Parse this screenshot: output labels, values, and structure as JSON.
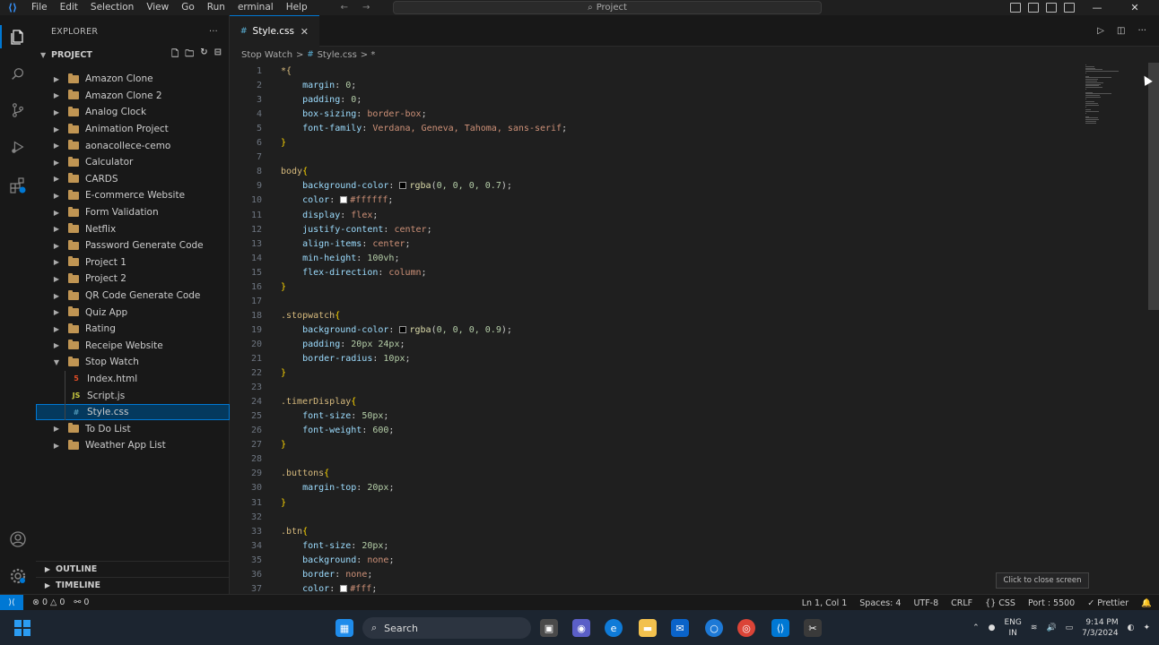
{
  "titlebar": {
    "menus": [
      "File",
      "Edit",
      "Selection",
      "View",
      "Go",
      "Run",
      "erminal",
      "Help"
    ],
    "search_text": "Project"
  },
  "sidebar": {
    "header": "EXPLORER",
    "project": "PROJECT",
    "folders_top": [
      "Amazon Clone",
      "Amazon Clone 2",
      "Analog Clock",
      "Animation Project",
      "aonacollece-cemo",
      "Calculator",
      "CARDS",
      "E-commerce Website",
      "Form Validation",
      "Netflix",
      "Password Generate Code",
      "Project 1",
      "Project 2",
      "QR Code Generate Code",
      "Quiz App",
      "Rating",
      "Receipe Website"
    ],
    "open_folder": "Stop Watch",
    "files": [
      {
        "icon": "5",
        "icon_color": "#e44d26",
        "name": "Index.html"
      },
      {
        "icon": "JS",
        "icon_color": "#cbcb41",
        "name": "Script.js"
      },
      {
        "icon": "#",
        "icon_color": "#519aba",
        "name": "Style.css"
      }
    ],
    "folders_bottom": [
      "To Do List",
      "Weather App List"
    ],
    "outline": "OUTLINE",
    "timeline": "TIMELINE"
  },
  "tab": {
    "label": "Style.css",
    "close": "✕"
  },
  "breadcrumb": {
    "folder": "Stop Watch",
    "sep": ">",
    "file": "Style.css",
    "extra": "> *"
  },
  "code_lines": [
    {
      "n": "1",
      "parts": [
        [
          "sel",
          "*{"
        ]
      ]
    },
    {
      "n": "2",
      "parts": [
        [
          "prop",
          "    margin"
        ],
        [
          "punc",
          ": "
        ],
        [
          "num",
          "0"
        ],
        [
          "punc",
          ";"
        ]
      ]
    },
    {
      "n": "3",
      "parts": [
        [
          "prop",
          "    padding"
        ],
        [
          "punc",
          ": "
        ],
        [
          "num",
          "0"
        ],
        [
          "punc",
          ";"
        ]
      ]
    },
    {
      "n": "4",
      "parts": [
        [
          "prop",
          "    box-sizing"
        ],
        [
          "punc",
          ": "
        ],
        [
          "val",
          "border-box"
        ],
        [
          "punc",
          ";"
        ]
      ]
    },
    {
      "n": "5",
      "parts": [
        [
          "prop",
          "    font-family"
        ],
        [
          "punc",
          ": "
        ],
        [
          "val",
          "Verdana, Geneva, Tahoma, sans-serif"
        ],
        [
          "punc",
          ";"
        ]
      ]
    },
    {
      "n": "6",
      "parts": [
        [
          "brace",
          "}"
        ]
      ]
    },
    {
      "n": "7",
      "parts": []
    },
    {
      "n": "8",
      "parts": [
        [
          "sel",
          "body"
        ],
        [
          "brace",
          "{"
        ]
      ]
    },
    {
      "n": "9",
      "parts": [
        [
          "prop",
          "    background-color"
        ],
        [
          "punc",
          ": "
        ],
        [
          "swatch",
          "#000000"
        ],
        [
          "fn",
          "rgba"
        ],
        [
          "punc",
          "("
        ],
        [
          "num",
          "0, 0, 0, 0.7"
        ],
        [
          "punc",
          ");"
        ]
      ]
    },
    {
      "n": "10",
      "parts": [
        [
          "prop",
          "    color"
        ],
        [
          "punc",
          ": "
        ],
        [
          "swatch",
          "#ffffff"
        ],
        [
          "val",
          "#ffffff"
        ],
        [
          "punc",
          ";"
        ]
      ]
    },
    {
      "n": "11",
      "parts": [
        [
          "prop",
          "    display"
        ],
        [
          "punc",
          ": "
        ],
        [
          "val",
          "flex"
        ],
        [
          "punc",
          ";"
        ]
      ]
    },
    {
      "n": "12",
      "parts": [
        [
          "prop",
          "    justify-content"
        ],
        [
          "punc",
          ": "
        ],
        [
          "val",
          "center"
        ],
        [
          "punc",
          ";"
        ]
      ]
    },
    {
      "n": "13",
      "parts": [
        [
          "prop",
          "    align-items"
        ],
        [
          "punc",
          ": "
        ],
        [
          "val",
          "center"
        ],
        [
          "punc",
          ";"
        ]
      ]
    },
    {
      "n": "14",
      "parts": [
        [
          "prop",
          "    min-height"
        ],
        [
          "punc",
          ": "
        ],
        [
          "num",
          "100vh"
        ],
        [
          "punc",
          ";"
        ]
      ]
    },
    {
      "n": "15",
      "parts": [
        [
          "prop",
          "    flex-direction"
        ],
        [
          "punc",
          ": "
        ],
        [
          "val",
          "column"
        ],
        [
          "punc",
          ";"
        ]
      ]
    },
    {
      "n": "16",
      "parts": [
        [
          "brace",
          "}"
        ]
      ]
    },
    {
      "n": "17",
      "parts": []
    },
    {
      "n": "18",
      "parts": [
        [
          "sel",
          ".stopwatch"
        ],
        [
          "brace",
          "{"
        ]
      ]
    },
    {
      "n": "19",
      "parts": [
        [
          "prop",
          "    background-color"
        ],
        [
          "punc",
          ": "
        ],
        [
          "swatch",
          "#000000"
        ],
        [
          "fn",
          "rgba"
        ],
        [
          "punc",
          "("
        ],
        [
          "num",
          "0, 0, 0, 0.9"
        ],
        [
          "punc",
          ");"
        ]
      ]
    },
    {
      "n": "20",
      "parts": [
        [
          "prop",
          "    padding"
        ],
        [
          "punc",
          ": "
        ],
        [
          "num",
          "20px 24px"
        ],
        [
          "punc",
          ";"
        ]
      ]
    },
    {
      "n": "21",
      "parts": [
        [
          "prop",
          "    border-radius"
        ],
        [
          "punc",
          ": "
        ],
        [
          "num",
          "10px"
        ],
        [
          "punc",
          ";"
        ]
      ]
    },
    {
      "n": "22",
      "parts": [
        [
          "brace",
          "}"
        ]
      ]
    },
    {
      "n": "23",
      "parts": []
    },
    {
      "n": "24",
      "parts": [
        [
          "sel",
          ".timerDisplay"
        ],
        [
          "brace",
          "{"
        ]
      ]
    },
    {
      "n": "25",
      "parts": [
        [
          "prop",
          "    font-size"
        ],
        [
          "punc",
          ": "
        ],
        [
          "num",
          "50px"
        ],
        [
          "punc",
          ";"
        ]
      ]
    },
    {
      "n": "26",
      "parts": [
        [
          "prop",
          "    font-weight"
        ],
        [
          "punc",
          ": "
        ],
        [
          "num",
          "600"
        ],
        [
          "punc",
          ";"
        ]
      ]
    },
    {
      "n": "27",
      "parts": [
        [
          "brace",
          "}"
        ]
      ]
    },
    {
      "n": "28",
      "parts": []
    },
    {
      "n": "29",
      "parts": [
        [
          "sel",
          ".buttons"
        ],
        [
          "brace",
          "{"
        ]
      ]
    },
    {
      "n": "30",
      "parts": [
        [
          "prop",
          "    margin-top"
        ],
        [
          "punc",
          ": "
        ],
        [
          "num",
          "20px"
        ],
        [
          "punc",
          ";"
        ]
      ]
    },
    {
      "n": "31",
      "parts": [
        [
          "brace",
          "}"
        ]
      ]
    },
    {
      "n": "32",
      "parts": []
    },
    {
      "n": "33",
      "parts": [
        [
          "sel",
          ".btn"
        ],
        [
          "brace",
          "{"
        ]
      ]
    },
    {
      "n": "34",
      "parts": [
        [
          "prop",
          "    font-size"
        ],
        [
          "punc",
          ": "
        ],
        [
          "num",
          "20px"
        ],
        [
          "punc",
          ";"
        ]
      ]
    },
    {
      "n": "35",
      "parts": [
        [
          "prop",
          "    background"
        ],
        [
          "punc",
          ": "
        ],
        [
          "val",
          "none"
        ],
        [
          "punc",
          ";"
        ]
      ]
    },
    {
      "n": "36",
      "parts": [
        [
          "prop",
          "    border"
        ],
        [
          "punc",
          ": "
        ],
        [
          "val",
          "none"
        ],
        [
          "punc",
          ";"
        ]
      ]
    },
    {
      "n": "37",
      "parts": [
        [
          "prop",
          "    color"
        ],
        [
          "punc",
          ": "
        ],
        [
          "swatch",
          "#ffffff"
        ],
        [
          "val",
          "#fff"
        ],
        [
          "punc",
          ";"
        ]
      ]
    }
  ],
  "tooltip": "Click to close screen",
  "statusbar": {
    "remote": "⟩⟨",
    "errors": "⊗ 0 △ 0",
    "ports": "⚯ 0",
    "position": "Ln 1, Col 1",
    "spaces": "Spaces: 4",
    "encoding": "UTF-8",
    "eol": "CRLF",
    "language": "{} CSS",
    "port": "Port : 5500",
    "prettier": "✓ Prettier"
  },
  "taskbar": {
    "search_placeholder": "Search",
    "lang_top": "ENG",
    "lang_bottom": "IN",
    "time": "9:14 PM",
    "date": "7/3/2024"
  }
}
